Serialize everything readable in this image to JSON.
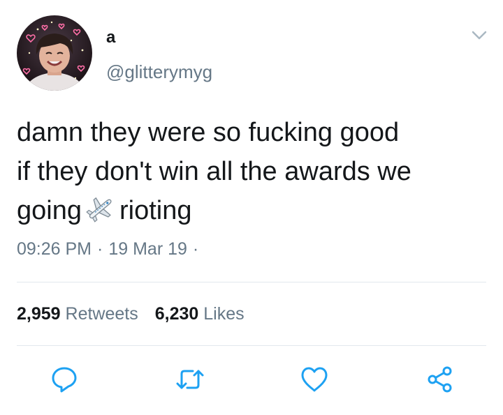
{
  "user": {
    "display_name": "a",
    "handle": "@glitterymyg"
  },
  "tweet": {
    "lines": [
      "damn they were so fucking good",
      "if they don't win all the awards we",
      "going"
    ],
    "after_emoji": "rioting",
    "emoji": "airplane-icon",
    "time": "09:26 PM",
    "date": "19 Mar 19",
    "dot": "·"
  },
  "stats": {
    "retweets_count": "2,959",
    "retweets_label": "Retweets",
    "likes_count": "6,230",
    "likes_label": "Likes"
  },
  "colors": {
    "text": "#14171a",
    "secondary": "#657786",
    "divider": "#e1e8ed",
    "icon": "#1da1f2"
  }
}
